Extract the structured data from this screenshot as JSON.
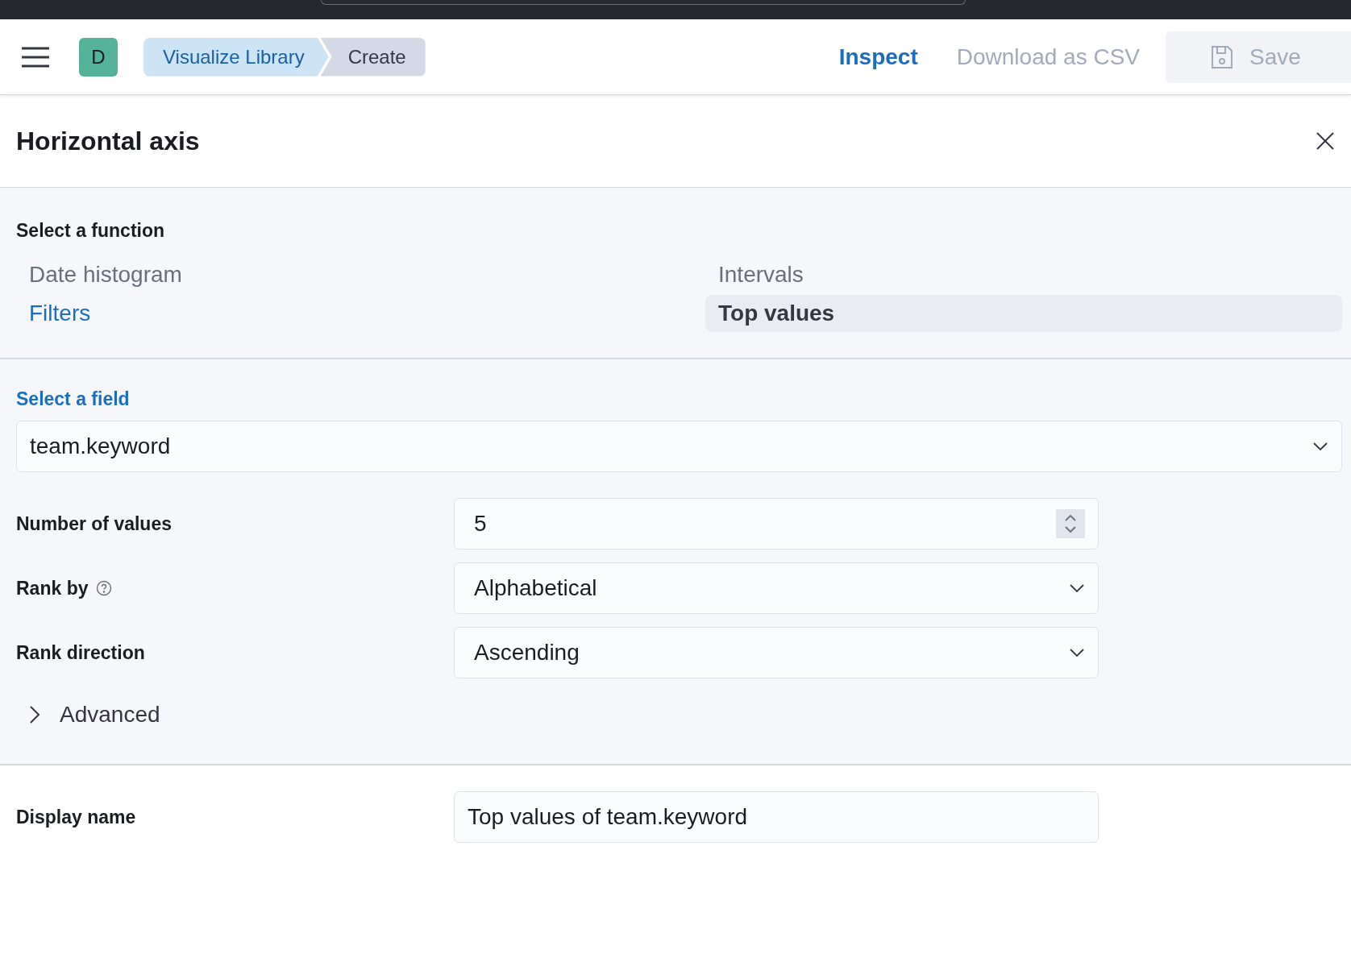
{
  "header": {
    "avatar": "D",
    "breadcrumbs": [
      {
        "label": "Visualize Library",
        "selected": false
      },
      {
        "label": "Create",
        "selected": true
      }
    ],
    "actions": [
      {
        "kind": "link",
        "label": "Inspect",
        "disabled": false
      },
      {
        "kind": "link",
        "label": "Download as CSV",
        "disabled": true
      },
      {
        "kind": "button",
        "label": "Save",
        "disabled": true
      }
    ]
  },
  "flyout": {
    "title": "Horizontal axis"
  },
  "function_section": {
    "label": "Select a function",
    "functions": [
      {
        "label": "Date histogram",
        "disabled": true,
        "selected": false
      },
      {
        "label": "Intervals",
        "disabled": true,
        "selected": false
      },
      {
        "label": "Filters",
        "disabled": false,
        "selected": false
      },
      {
        "label": "Top values",
        "disabled": false,
        "selected": true
      }
    ]
  },
  "field_section": {
    "label": "Select a field",
    "value": "team.keyword"
  },
  "settings": [
    {
      "kind": "number",
      "label": "Number of values",
      "value": "5",
      "help": false
    },
    {
      "kind": "select",
      "label": "Rank by",
      "value": "Alphabetical",
      "help": true
    },
    {
      "kind": "select",
      "label": "Rank direction",
      "value": "Ascending",
      "help": false
    }
  ],
  "advanced": {
    "label": "Advanced",
    "expanded": false
  },
  "display_name": {
    "label": "Display name",
    "value": "Top values of team.keyword"
  }
}
